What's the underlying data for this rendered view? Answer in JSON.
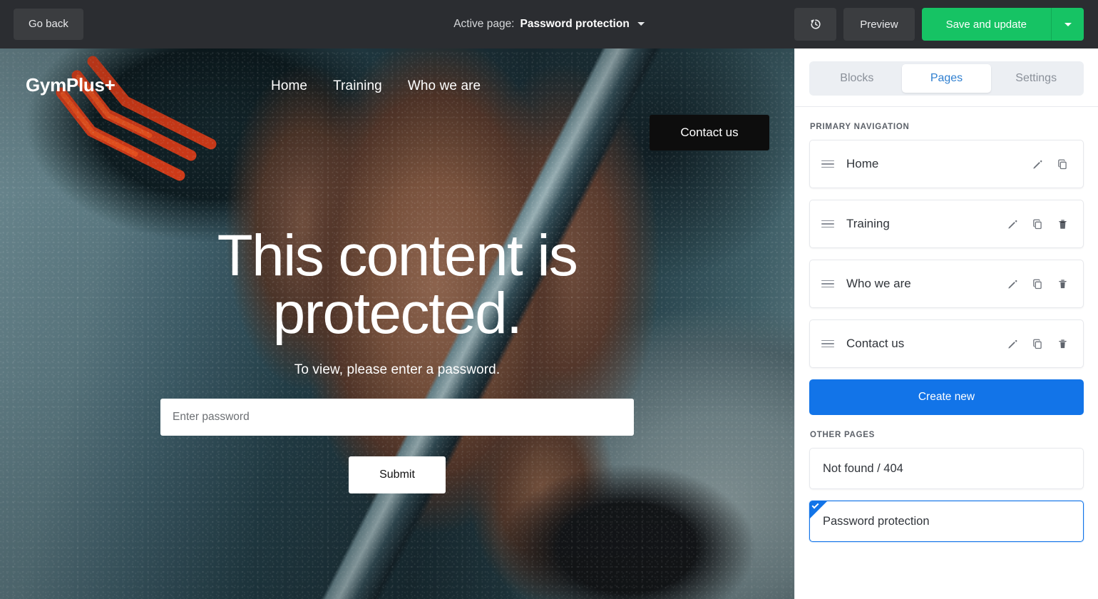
{
  "topbar": {
    "go_back_label": "Go back",
    "active_page_label": "Active page:",
    "active_page_value": "Password protection",
    "history_icon": "history-clock-icon",
    "preview_label": "Preview",
    "save_label": "Save and update",
    "save_dropdown_icon": "chevron-down-icon",
    "colors": {
      "bar_bg": "#2b2d31",
      "button_bg": "#3b3d40",
      "save_green": "#16c364"
    }
  },
  "site_preview": {
    "logo": "GymPlus+",
    "nav": [
      {
        "label": "Home"
      },
      {
        "label": "Training"
      },
      {
        "label": "Who we are"
      }
    ],
    "cta_label": "Contact us",
    "hero_title": "This content is protected.",
    "hero_subtitle": "To view, please enter a password.",
    "password_placeholder": "Enter password",
    "password_value": "",
    "submit_label": "Submit"
  },
  "sidebar": {
    "tabs": [
      {
        "label": "Blocks",
        "active": false
      },
      {
        "label": "Pages",
        "active": true
      },
      {
        "label": "Settings",
        "active": false
      }
    ],
    "primary_nav_heading": "PRIMARY NAVIGATION",
    "primary_pages": [
      {
        "label": "Home",
        "can_delete": false
      },
      {
        "label": "Training",
        "can_delete": true
      },
      {
        "label": "Who we are",
        "can_delete": true
      },
      {
        "label": "Contact us",
        "can_delete": true
      }
    ],
    "create_new_label": "Create new",
    "other_pages_heading": "OTHER PAGES",
    "other_pages": [
      {
        "label": "Not found / 404",
        "selected": false
      },
      {
        "label": "Password protection",
        "selected": true
      }
    ],
    "icons": {
      "drag": "drag-handle-icon",
      "edit": "pencil-edit-icon",
      "duplicate": "copy-duplicate-icon",
      "delete": "trash-delete-icon",
      "selected_check": "check-icon"
    },
    "colors": {
      "accent_blue": "#1274e8",
      "tab_active_text": "#2f7fd0",
      "tab_track": "#eceff3"
    }
  }
}
